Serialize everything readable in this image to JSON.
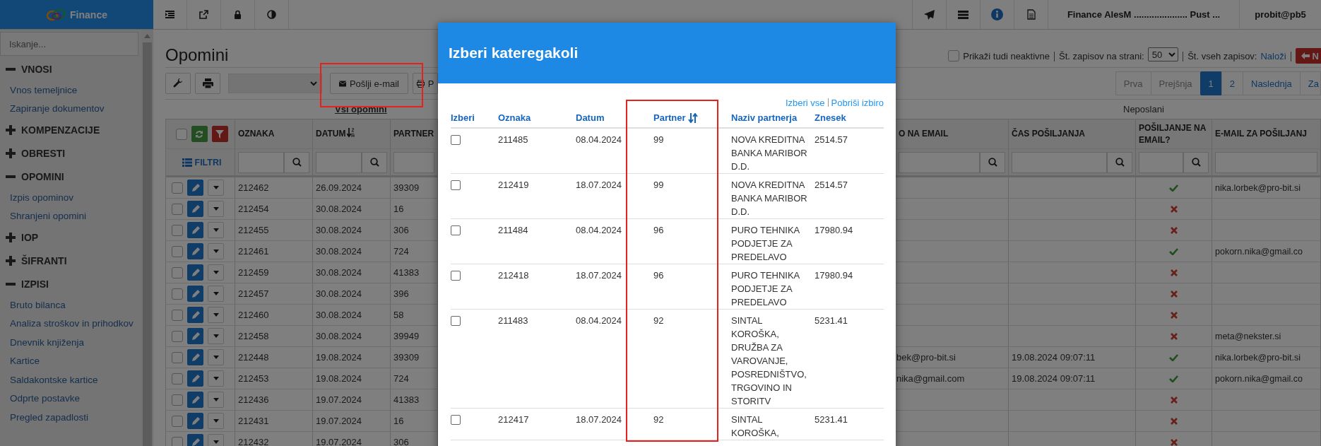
{
  "app": {
    "brand": "Finance",
    "user_info": "Finance AlesM ..................... Pust ...",
    "user": "probit@pb5"
  },
  "sidebar": {
    "search": {
      "placeholder": "Iskanje..."
    },
    "groups": [
      {
        "label": "VNOSI",
        "expanded": true,
        "children": [
          {
            "label": "Vnos temeljnice"
          },
          {
            "label": "Zapiranje dokumentov"
          }
        ]
      },
      {
        "label": "KOMPENZACIJE",
        "expanded": false
      },
      {
        "label": "OBRESTI",
        "expanded": false
      },
      {
        "label": "OPOMINI",
        "expanded": true,
        "children": [
          {
            "label": "Izpis opominov"
          },
          {
            "label": "Shranjeni opomini"
          }
        ]
      },
      {
        "label": "IOP",
        "expanded": false
      },
      {
        "label": "ŠIFRANTI",
        "expanded": false
      },
      {
        "label": "IZPISI",
        "expanded": true,
        "children": [
          {
            "label": "Bruto bilanca"
          },
          {
            "label": "Analiza stroškov in prihodkov"
          },
          {
            "label": "Dnevnik knjiženja"
          },
          {
            "label": "Kartice"
          },
          {
            "label": "Saldakontske kartice"
          },
          {
            "label": "Odprte postavke"
          },
          {
            "label": "Pregled zapadlosti"
          }
        ]
      }
    ]
  },
  "page": {
    "title": "Opomini",
    "toolbar": {
      "send_email": "Pošlji e-mail",
      "partial_button": "P"
    },
    "show_inactive": {
      "label": "Prikaži tudi neaktivne",
      "checked": false
    },
    "page_size": {
      "label": "Št. zapisov na strani:",
      "value": "50"
    },
    "total": {
      "label": "Št. vseh zapisov:",
      "link": "Naloži"
    },
    "back_button": "N",
    "pagination": [
      {
        "label": "Prva",
        "selected": false,
        "disabled": true
      },
      {
        "label": "Prejšnja",
        "selected": false,
        "disabled": true
      },
      {
        "label": "1",
        "selected": true,
        "disabled": false
      },
      {
        "label": "2",
        "selected": false,
        "disabled": false
      },
      {
        "label": "Naslednja",
        "selected": false,
        "disabled": false
      },
      {
        "label": "Za",
        "selected": false,
        "disabled": false
      }
    ],
    "tabs": [
      {
        "label": "Vsi opomini",
        "selected": true
      },
      {
        "label": "Neposlani",
        "selected": false
      }
    ]
  },
  "table": {
    "filter_label": "FILTRI",
    "all_checked": false,
    "columns_left": [
      {
        "label": "OZNAKA",
        "sorted": false
      },
      {
        "label": "DATUM",
        "sorted": true
      },
      {
        "label": "PARTNER",
        "sorted": false
      }
    ],
    "columns_right": [
      "O NA EMAIL",
      "ČAS POŠILJANJA",
      "POŠILJANJE NA EMAIL?",
      "E-MAIL ZA POŠILJANJ"
    ],
    "rows": [
      {
        "checked": false,
        "oznaka": "212462",
        "datum": "26.09.2024",
        "partner": "39309",
        "send_email": true,
        "email": "nika.lorbek@pro-bit.si"
      },
      {
        "checked": false,
        "oznaka": "212454",
        "datum": "30.08.2024",
        "partner": "16",
        "send_email": false
      },
      {
        "checked": false,
        "oznaka": "212455",
        "datum": "30.08.2024",
        "partner": "306",
        "send_email": false
      },
      {
        "checked": false,
        "oznaka": "212461",
        "datum": "30.08.2024",
        "partner": "724",
        "send_email": true,
        "email": "pokorn.nika@gmail.co"
      },
      {
        "checked": false,
        "oznaka": "212459",
        "datum": "30.08.2024",
        "partner": "41383",
        "send_email": false
      },
      {
        "checked": false,
        "oznaka": "212457",
        "datum": "30.08.2024",
        "partner": "396",
        "send_email": false
      },
      {
        "checked": false,
        "oznaka": "212460",
        "datum": "30.08.2024",
        "partner": "58",
        "send_email": false
      },
      {
        "checked": false,
        "oznaka": "212458",
        "datum": "30.08.2024",
        "partner": "39949",
        "send_email": false,
        "email": "meta@nekster.si"
      },
      {
        "checked": false,
        "oznaka": "212448",
        "datum": "19.08.2024",
        "partner": "39309",
        "column_4": "bek@pro-bit.si",
        "sent_time": "19.08.2024 09:07:11",
        "send_email": true,
        "email": "nika.lorbek@pro-bit.si"
      },
      {
        "checked": false,
        "oznaka": "212453",
        "datum": "19.08.2024",
        "partner": "724",
        "column_4": "nika@gmail.com",
        "sent_time": "19.08.2024 09:07:11",
        "send_email": true,
        "email": "pokorn.nika@gmail.co"
      },
      {
        "checked": false,
        "oznaka": "212436",
        "datum": "19.07.2024",
        "partner": "41383",
        "send_email": false
      },
      {
        "checked": false,
        "oznaka": "212431",
        "datum": "19.07.2024",
        "partner": "16",
        "send_email": false
      },
      {
        "checked": false,
        "oznaka": "212432",
        "datum": "19.07.2024",
        "partner": "306",
        "send_email": false
      }
    ]
  },
  "modal": {
    "title": "Izberi kateregakoli",
    "select_all": "Izberi vse",
    "clear": "Pobriši izbiro",
    "columns": [
      {
        "label": "Izberi",
        "sorted": false
      },
      {
        "label": "Oznaka",
        "sorted": false
      },
      {
        "label": "Datum",
        "sorted": false
      },
      {
        "label": "Partner",
        "sorted": true
      },
      {
        "label": "Naziv partnerja",
        "sorted": false
      },
      {
        "label": "Znesek",
        "sorted": false
      }
    ],
    "rows": [
      {
        "checked": false,
        "oznaka": "211485",
        "datum": "08.04.2024",
        "partner": "99",
        "naziv": "NOVA KREDITNA BANKA MARIBOR D.D.",
        "znesek": "2514.57"
      },
      {
        "checked": false,
        "oznaka": "212419",
        "datum": "18.07.2024",
        "partner": "99",
        "naziv": "NOVA KREDITNA BANKA MARIBOR D.D.",
        "znesek": "2514.57"
      },
      {
        "checked": false,
        "oznaka": "211484",
        "datum": "08.04.2024",
        "partner": "96",
        "naziv": "PURO TEHNIKA PODJETJE ZA PREDELAVO",
        "znesek": "17980.94"
      },
      {
        "checked": false,
        "oznaka": "212418",
        "datum": "18.07.2024",
        "partner": "96",
        "naziv": "PURO TEHNIKA PODJETJE ZA PREDELAVO",
        "znesek": "17980.94"
      },
      {
        "checked": false,
        "oznaka": "211483",
        "datum": "08.04.2024",
        "partner": "92",
        "naziv": "SINTAL KOROŠKA, DRUŽBA ZA VAROVANJE, POSREDNIŠTVO, TRGOVINO IN STORITV",
        "znesek": "5231.41"
      },
      {
        "checked": false,
        "oznaka": "212417",
        "datum": "18.07.2024",
        "partner": "92",
        "naziv": "SINTAL KOROŠKA,",
        "znesek": "5231.41"
      }
    ]
  }
}
